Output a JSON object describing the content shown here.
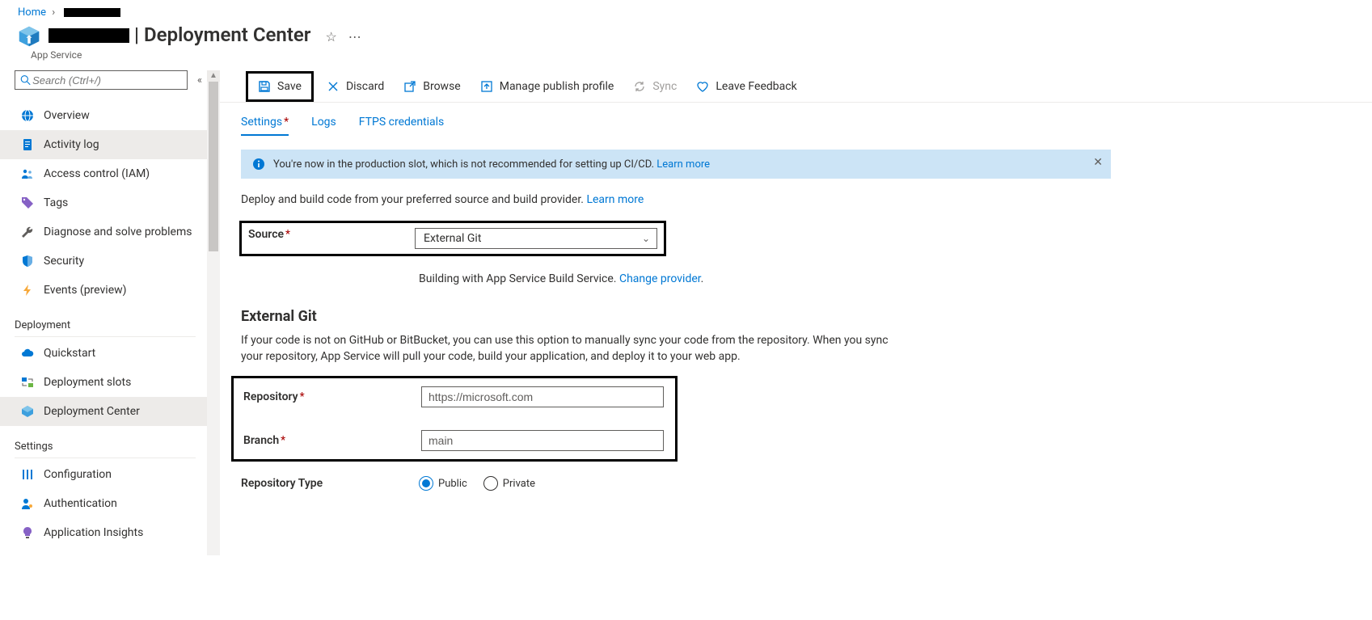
{
  "breadcrumb": {
    "home": "Home"
  },
  "header": {
    "title": "Deployment Center",
    "subtitle": "App Service"
  },
  "sidebar": {
    "search_placeholder": "Search (Ctrl+/)",
    "items": {
      "overview": "Overview",
      "activity_log": "Activity log",
      "access_control": "Access control (IAM)",
      "tags": "Tags",
      "diagnose": "Diagnose and solve problems",
      "security": "Security",
      "events": "Events (preview)"
    },
    "sections": {
      "deployment": "Deployment",
      "settings": "Settings"
    },
    "deployment_items": {
      "quickstart": "Quickstart",
      "deployment_slots": "Deployment slots",
      "deployment_center": "Deployment Center"
    },
    "settings_items": {
      "configuration": "Configuration",
      "authentication": "Authentication",
      "application_insights": "Application Insights"
    }
  },
  "toolbar": {
    "save": "Save",
    "discard": "Discard",
    "browse": "Browse",
    "manage_publish": "Manage publish profile",
    "sync": "Sync",
    "feedback": "Leave Feedback"
  },
  "tabs": {
    "settings": "Settings",
    "logs": "Logs",
    "ftps": "FTPS credentials"
  },
  "banner": {
    "text": "You're now in the production slot, which is not recommended for setting up CI/CD.",
    "learn_more": "Learn more"
  },
  "deploy_intro": {
    "text": "Deploy and build code from your preferred source and build provider.",
    "learn_more": "Learn more"
  },
  "form": {
    "source_label": "Source",
    "source_value": "External Git",
    "build_text": "Building with App Service Build Service.",
    "change_provider": "Change provider",
    "section_title": "External Git",
    "section_desc": "If your code is not on GitHub or BitBucket, you can use this option to manually sync your code from the repository. When you sync your repository, App Service will pull your code, build your application, and deploy it to your web app.",
    "repository_label": "Repository",
    "repository_placeholder": "https://microsoft.com",
    "branch_label": "Branch",
    "branch_placeholder": "main",
    "repo_type_label": "Repository Type",
    "repo_type_public": "Public",
    "repo_type_private": "Private"
  }
}
